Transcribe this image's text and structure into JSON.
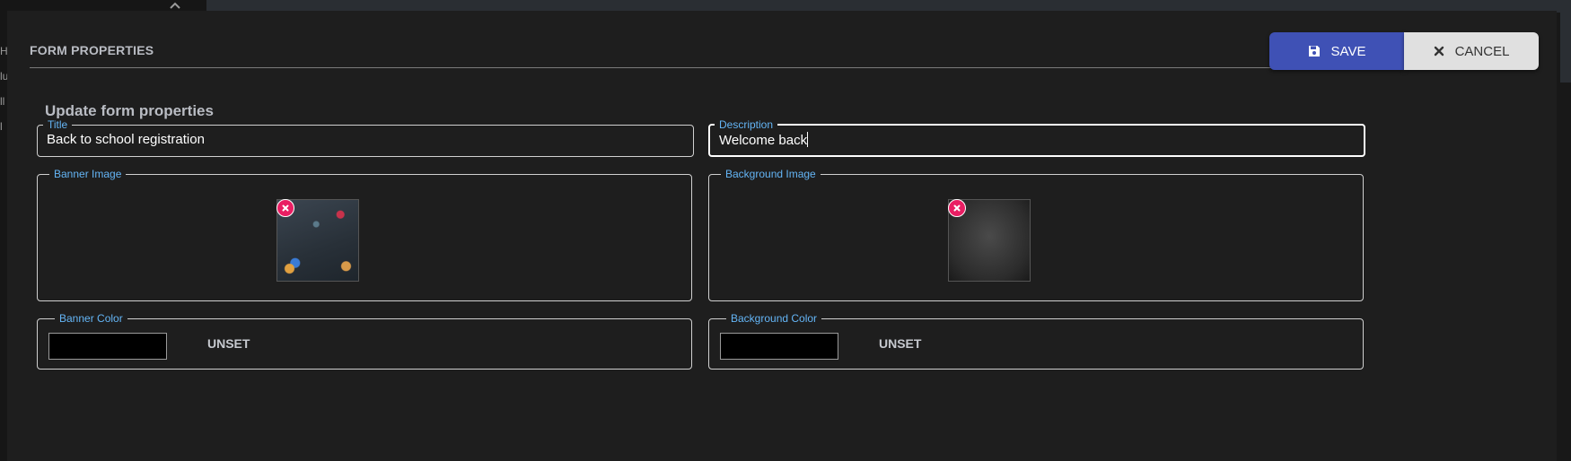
{
  "background_app": {
    "left_fragments": [
      "He",
      "lu",
      "ll",
      "l"
    ]
  },
  "dialog": {
    "title": "FORM PROPERTIES",
    "save_label": "SAVE",
    "cancel_label": "CANCEL",
    "section_title": "Update form properties"
  },
  "fields": {
    "title": {
      "label": "Title",
      "value": "Back to school registration"
    },
    "description": {
      "label": "Description",
      "value": "Welcome back"
    },
    "banner_image": {
      "label": "Banner Image"
    },
    "background_image": {
      "label": "Background Image"
    },
    "banner_color": {
      "label": "Banner Color",
      "value": "#000000",
      "unset_label": "UNSET"
    },
    "background_color": {
      "label": "Background Color",
      "value": "#000000",
      "unset_label": "UNSET"
    }
  },
  "colors": {
    "accent_primary": "#3f51b5",
    "label_blue": "#64b5f6",
    "remove_badge": "#e91e63"
  },
  "icons": {
    "save": "floppy-disk-icon",
    "cancel": "close-icon",
    "remove": "remove-image-icon"
  }
}
